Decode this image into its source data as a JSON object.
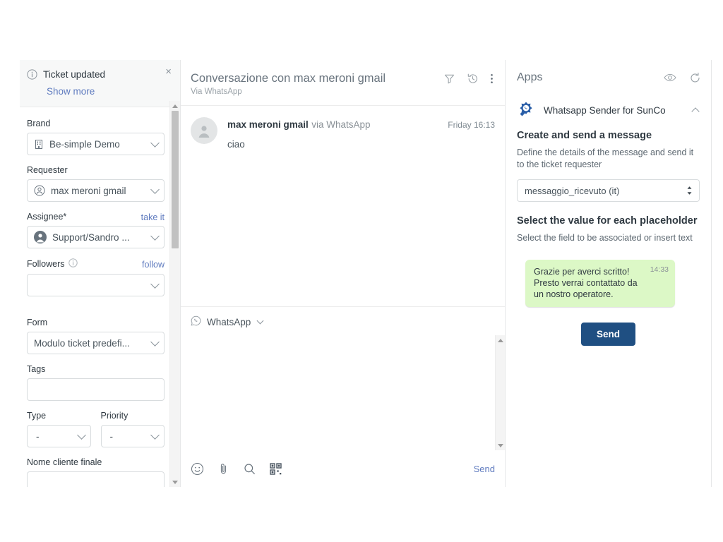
{
  "banner": {
    "title": "Ticket updated",
    "link": "Show more",
    "close": "×",
    "info_icon": "info-icon"
  },
  "sidebar": {
    "fields": [
      {
        "label": "Brand",
        "value": "Be-simple Demo",
        "icon": "building-icon"
      },
      {
        "label": "Requester",
        "value": "max meroni gmail",
        "icon": "user-outline-icon"
      },
      {
        "label": "Assignee*",
        "value": "Support/Sandro ...",
        "icon": "user-filled-icon",
        "action": "take it"
      },
      {
        "label": "Followers",
        "value": "",
        "icon": "",
        "action": "follow",
        "has_info": true
      },
      {
        "label": "Form",
        "value": "Modulo ticket predefi...",
        "icon": ""
      },
      {
        "label": "Tags",
        "value": "",
        "icon": ""
      }
    ],
    "type_field": {
      "label": "Type",
      "value": "-"
    },
    "priority_field": {
      "label": "Priority",
      "value": "-"
    },
    "last_field": {
      "label": "Nome cliente finale",
      "value": ""
    }
  },
  "conversation": {
    "title": "Conversazione con max meroni gmail",
    "subtitle": "Via WhatsApp",
    "icons": [
      "filter-icon",
      "history-icon",
      "more-vertical-icon"
    ],
    "message": {
      "author": "max meroni gmail",
      "via": "via WhatsApp",
      "time": "Friday 16:13",
      "text": "ciao",
      "avatar": "avatar-placeholder-icon"
    },
    "composer": {
      "channel": "WhatsApp",
      "channel_icon": "whatsapp-icon",
      "tools": [
        "emoji-icon",
        "attachment-icon",
        "search-icon",
        "macro-icon"
      ],
      "send_label": "Send"
    }
  },
  "apps": {
    "title": "Apps",
    "header_icons": [
      "eye-icon",
      "refresh-icon"
    ],
    "app": {
      "name": "Whatsapp Sender for SunCo",
      "logo": "whatsapp-sender-logo-icon",
      "collapse_icon": "chevron-up-icon"
    },
    "section1": {
      "heading": "Create and send a message",
      "description": "Define the details of the message and send it to the ticket requester",
      "template_value": "messaggio_ricevuto (it)"
    },
    "section2": {
      "heading": "Select the value for each placeholder",
      "description": "Select the field to be associated or insert text"
    },
    "preview": {
      "text": "Grazie per averci scritto!\nPresto verrai contattato da un nostro operatore.",
      "time": "14:33",
      "bubble_color": "#dcf8c6"
    },
    "send_button": "Send"
  },
  "colors": {
    "link": "#5f7bbf",
    "send_button": "#1f4f82",
    "bubble": "#dcf8c6",
    "banner_bg": "#f7f8f8"
  }
}
